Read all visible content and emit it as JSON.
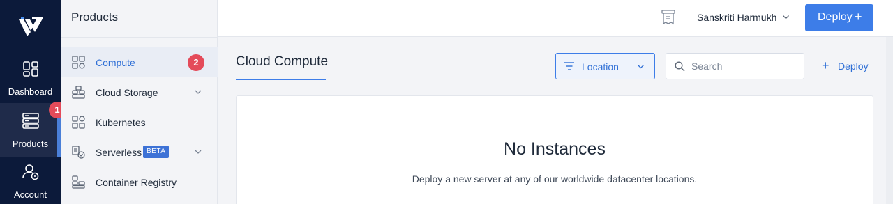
{
  "rail": {
    "items": [
      {
        "label": "Dashboard"
      },
      {
        "label": "Products"
      },
      {
        "label": "Account"
      }
    ],
    "badge": "1"
  },
  "subnav": {
    "title": "Products",
    "items": [
      {
        "label": "Compute",
        "badge": "2"
      },
      {
        "label": "Cloud Storage"
      },
      {
        "label": "Kubernetes"
      },
      {
        "label": "Serverless",
        "tag": "BETA"
      },
      {
        "label": "Container Registry"
      }
    ]
  },
  "header": {
    "user_name": "Sanskriti Harmukh",
    "deploy_label": "Deploy",
    "deploy_plus": "+"
  },
  "main": {
    "title": "Cloud Compute",
    "location_label": "Location",
    "search_placeholder": "Search",
    "deploy_link": "Deploy",
    "deploy_link_plus": "+",
    "empty_title": "No Instances",
    "empty_text": "Deploy a new server at any of our worldwide datacenter locations."
  },
  "colors": {
    "rail_bg": "#0c1a3a",
    "accent": "#3d7de8",
    "badge": "#e44b5a"
  }
}
